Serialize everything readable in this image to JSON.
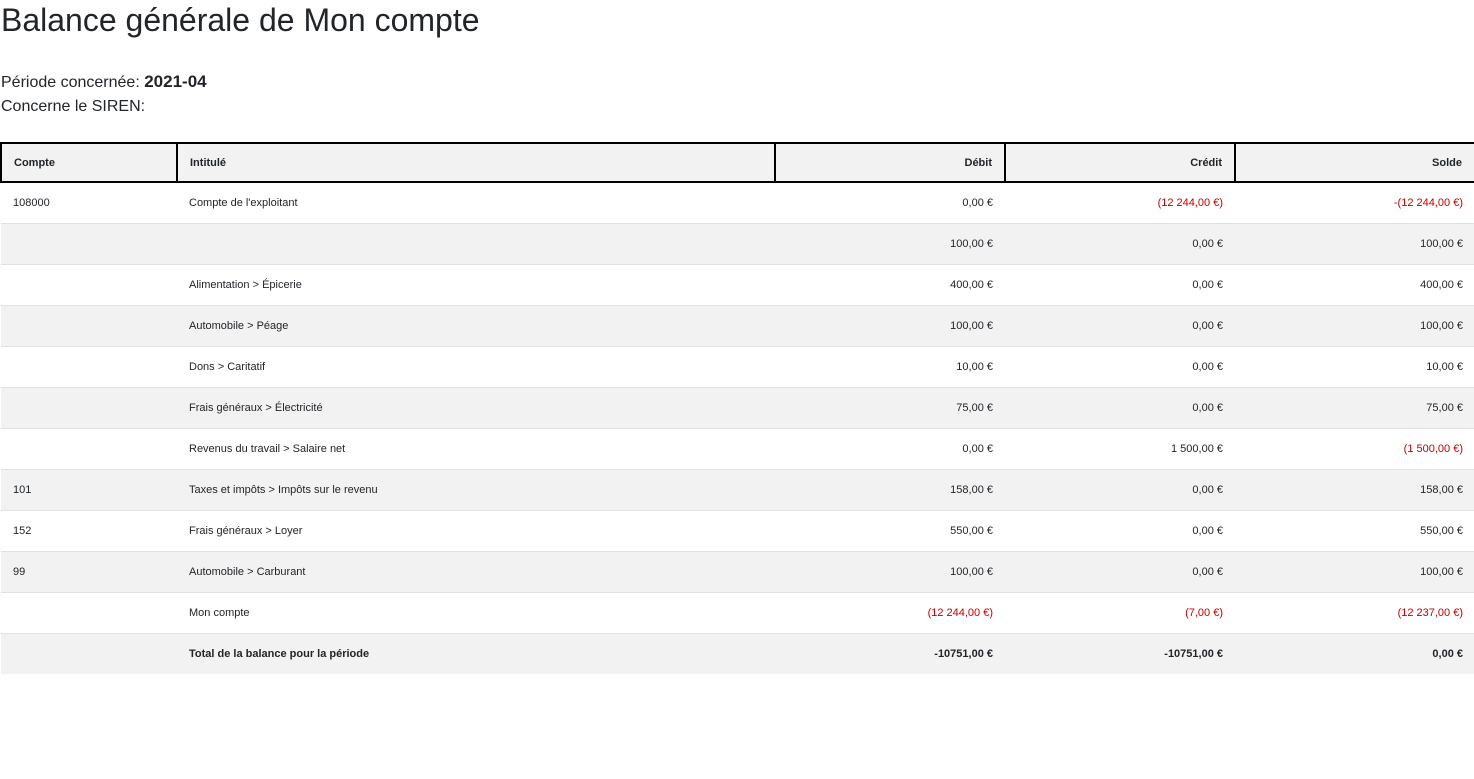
{
  "page": {
    "title": "Balance générale de Mon compte",
    "period_label": "Période concernée:",
    "period_value": "2021-04",
    "siren_label": "Concerne le SIREN:",
    "siren_value": ""
  },
  "table": {
    "headers": {
      "compte": "Compte",
      "intitule": "Intitulé",
      "debit": "Débit",
      "credit": "Crédit",
      "solde": "Solde"
    },
    "rows": [
      {
        "compte": "108000",
        "intitule": "Compte de l'exploitant",
        "debit": "0,00 €",
        "credit": "(12 244,00 €)",
        "solde": "-(12 244,00 €)"
      },
      {
        "compte": "",
        "intitule": "",
        "debit": "100,00 €",
        "credit": "0,00 €",
        "solde": "100,00 €"
      },
      {
        "compte": "",
        "intitule": "Alimentation > Épicerie",
        "debit": "400,00 €",
        "credit": "0,00 €",
        "solde": "400,00 €"
      },
      {
        "compte": "",
        "intitule": "Automobile > Péage",
        "debit": "100,00 €",
        "credit": "0,00 €",
        "solde": "100,00 €"
      },
      {
        "compte": "",
        "intitule": "Dons > Caritatif",
        "debit": "10,00 €",
        "credit": "0,00 €",
        "solde": "10,00 €"
      },
      {
        "compte": "",
        "intitule": "Frais généraux > Électricité",
        "debit": "75,00 €",
        "credit": "0,00 €",
        "solde": "75,00 €"
      },
      {
        "compte": "",
        "intitule": "Revenus du travail > Salaire net",
        "debit": "0,00 €",
        "credit": "1 500,00 €",
        "solde": "(1 500,00 €)"
      },
      {
        "compte": "101",
        "intitule": "Taxes et impôts > Impôts sur le revenu",
        "debit": "158,00 €",
        "credit": "0,00 €",
        "solde": "158,00 €"
      },
      {
        "compte": "152",
        "intitule": "Frais généraux > Loyer",
        "debit": "550,00 €",
        "credit": "0,00 €",
        "solde": "550,00 €"
      },
      {
        "compte": "99",
        "intitule": "Automobile > Carburant",
        "debit": "100,00 €",
        "credit": "0,00 €",
        "solde": "100,00 €"
      },
      {
        "compte": "",
        "intitule": "Mon compte",
        "debit": "(12 244,00 €)",
        "credit": "(7,00 €)",
        "solde": "(12 237,00 €)"
      }
    ],
    "total": {
      "compte": "",
      "intitule": "Total de la balance pour la période",
      "debit": "-10751,00 €",
      "credit": "-10751,00 €",
      "solde": "0,00 €"
    }
  },
  "colors": {
    "negative": "#c00000",
    "stripe": "#f2f2f2",
    "header_border": "#000000"
  }
}
